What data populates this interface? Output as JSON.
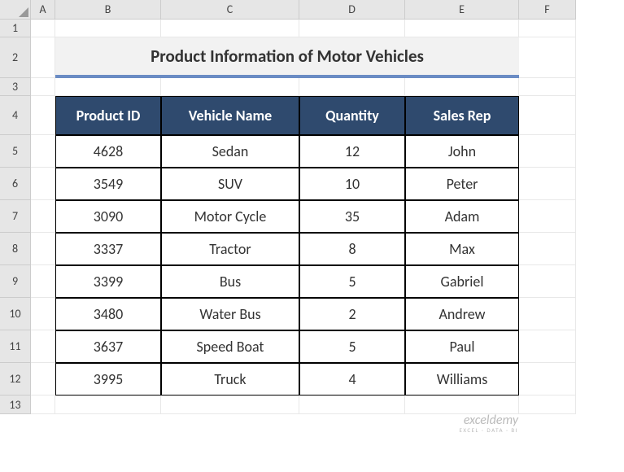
{
  "columns": [
    "",
    "A",
    "B",
    "C",
    "D",
    "E",
    "F"
  ],
  "rows": [
    "1",
    "2",
    "3",
    "4",
    "5",
    "6",
    "7",
    "8",
    "9",
    "10",
    "11",
    "12",
    "13"
  ],
  "title": "Product Information of Motor Vehicles",
  "table": {
    "headers": [
      "Product ID",
      "Vehicle Name",
      "Quantity",
      "Sales Rep"
    ],
    "data": [
      {
        "id": "4628",
        "name": "Sedan",
        "qty": "12",
        "rep": "John"
      },
      {
        "id": "3549",
        "name": "SUV",
        "qty": "10",
        "rep": "Peter"
      },
      {
        "id": "3090",
        "name": "Motor Cycle",
        "qty": "35",
        "rep": "Adam"
      },
      {
        "id": "3337",
        "name": "Tractor",
        "qty": "8",
        "rep": "Max"
      },
      {
        "id": "3399",
        "name": "Bus",
        "qty": "5",
        "rep": "Gabriel"
      },
      {
        "id": "3480",
        "name": "Water Bus",
        "qty": "2",
        "rep": "Andrew"
      },
      {
        "id": "3637",
        "name": "Speed Boat",
        "qty": "5",
        "rep": "Paul"
      },
      {
        "id": "3995",
        "name": "Truck",
        "qty": "4",
        "rep": "Williams"
      }
    ]
  },
  "watermark": {
    "main": "exceldemy",
    "sub": "EXCEL · DATA · BI"
  },
  "chart_data": {
    "type": "table",
    "title": "Product Information of Motor Vehicles",
    "headers": [
      "Product ID",
      "Vehicle Name",
      "Quantity",
      "Sales Rep"
    ],
    "rows": [
      [
        "4628",
        "Sedan",
        12,
        "John"
      ],
      [
        "3549",
        "SUV",
        10,
        "Peter"
      ],
      [
        "3090",
        "Motor Cycle",
        35,
        "Adam"
      ],
      [
        "3337",
        "Tractor",
        8,
        "Max"
      ],
      [
        "3399",
        "Bus",
        5,
        "Gabriel"
      ],
      [
        "3480",
        "Water Bus",
        2,
        "Andrew"
      ],
      [
        "3637",
        "Speed Boat",
        5,
        "Paul"
      ],
      [
        "3995",
        "Truck",
        4,
        "Williams"
      ]
    ]
  }
}
